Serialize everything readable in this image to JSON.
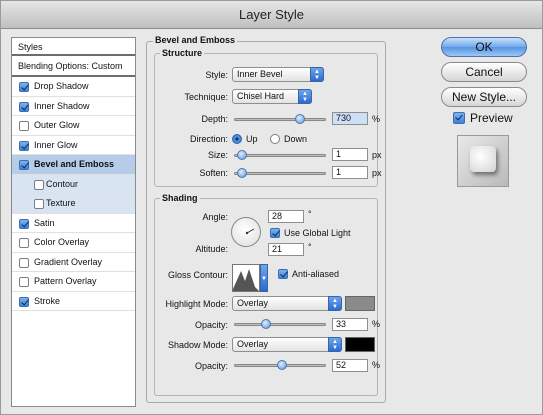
{
  "window": {
    "title": "Layer Style"
  },
  "styles_panel": {
    "header": "Styles",
    "items": [
      {
        "label": "Blending Options: Custom",
        "checkbox": false,
        "checked": false,
        "sub": false,
        "active": false
      },
      {
        "label": "Drop Shadow",
        "checkbox": true,
        "checked": true,
        "sub": false,
        "active": false
      },
      {
        "label": "Inner Shadow",
        "checkbox": true,
        "checked": true,
        "sub": false,
        "active": false
      },
      {
        "label": "Outer Glow",
        "checkbox": true,
        "checked": false,
        "sub": false,
        "active": false
      },
      {
        "label": "Inner Glow",
        "checkbox": true,
        "checked": true,
        "sub": false,
        "active": false
      },
      {
        "label": "Bevel and Emboss",
        "checkbox": true,
        "checked": true,
        "sub": false,
        "active": true
      },
      {
        "label": "Contour",
        "checkbox": true,
        "checked": false,
        "sub": true,
        "active": false
      },
      {
        "label": "Texture",
        "checkbox": true,
        "checked": false,
        "sub": true,
        "active": false
      },
      {
        "label": "Satin",
        "checkbox": true,
        "checked": true,
        "sub": false,
        "active": false
      },
      {
        "label": "Color Overlay",
        "checkbox": true,
        "checked": false,
        "sub": false,
        "active": false
      },
      {
        "label": "Gradient Overlay",
        "checkbox": true,
        "checked": false,
        "sub": false,
        "active": false
      },
      {
        "label": "Pattern Overlay",
        "checkbox": true,
        "checked": false,
        "sub": false,
        "active": false
      },
      {
        "label": "Stroke",
        "checkbox": true,
        "checked": true,
        "sub": false,
        "active": false
      }
    ]
  },
  "bevel": {
    "title": "Bevel and Emboss",
    "structure": {
      "title": "Structure",
      "style_label": "Style:",
      "style_value": "Inner Bevel",
      "technique_label": "Technique:",
      "technique_value": "Chisel Hard",
      "depth_label": "Depth:",
      "depth_value": "730",
      "depth_unit": "%",
      "depth_level": 0.75,
      "direction_label": "Direction:",
      "direction_up": "Up",
      "direction_down": "Down",
      "direction_selected": "Up",
      "size_label": "Size:",
      "size_value": "1",
      "size_unit": "px",
      "size_level": 0.02,
      "soften_label": "Soften:",
      "soften_value": "1",
      "soften_unit": "px",
      "soften_level": 0.02
    },
    "shading": {
      "title": "Shading",
      "angle_label": "Angle:",
      "angle_value": "28",
      "angle_unit": "°",
      "global_light_label": "Use Global Light",
      "altitude_label": "Altitude:",
      "altitude_value": "21",
      "altitude_unit": "°",
      "gloss_label": "Gloss Contour:",
      "anti_aliased_label": "Anti-aliased",
      "highlight_mode_label": "Highlight Mode:",
      "highlight_mode_value": "Overlay",
      "highlight_color": "#8a8a8a",
      "highlight_opacity_label": "Opacity:",
      "highlight_opacity_value": "33",
      "highlight_opacity_unit": "%",
      "highlight_opacity_level": 0.33,
      "shadow_mode_label": "Shadow Mode:",
      "shadow_mode_value": "Overlay",
      "shadow_color": "#000000",
      "shadow_opacity_label": "Opacity:",
      "shadow_opacity_value": "52",
      "shadow_opacity_unit": "%",
      "shadow_opacity_level": 0.52
    }
  },
  "buttons": {
    "ok": "OK",
    "cancel": "Cancel",
    "new_style": "New Style...",
    "preview_label": "Preview"
  },
  "colors": {
    "accent": "#3e82d8",
    "selection": "#b5cde9"
  }
}
